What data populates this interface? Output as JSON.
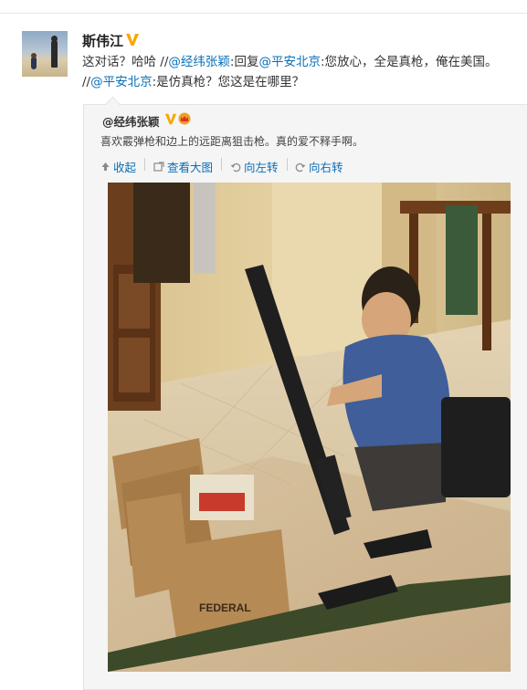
{
  "post": {
    "author": "斯伟江",
    "text_prefix": "这对话？哈哈 //",
    "mention1": "@经纬张颖",
    "text_mid1": ":回复",
    "mention2": "@平安北京",
    "text_mid2": ":您放心，全是真枪，俺在美国。 //",
    "mention3": "@平安北京",
    "text_suffix": ":是仿真枪？您这是在哪里？"
  },
  "repost": {
    "author": "@经纬张颖",
    "text": "喜欢霰弹枪和边上的远距离狙击枪。真的爱不释手啊。"
  },
  "actions": {
    "collapse": "收起",
    "view_large": "查看大图",
    "rotate_left": "向左转",
    "rotate_right": "向右转"
  },
  "photo_brand_text": "FEDERAL",
  "colors": {
    "link": "#0a6fb8",
    "verified": "#f5a800",
    "quote_bg": "#f5f5f5"
  },
  "icons": [
    "verified-badge-icon",
    "crown-icon",
    "collapse-arrow-icon",
    "view-large-icon",
    "rotate-left-icon",
    "rotate-right-icon"
  ]
}
